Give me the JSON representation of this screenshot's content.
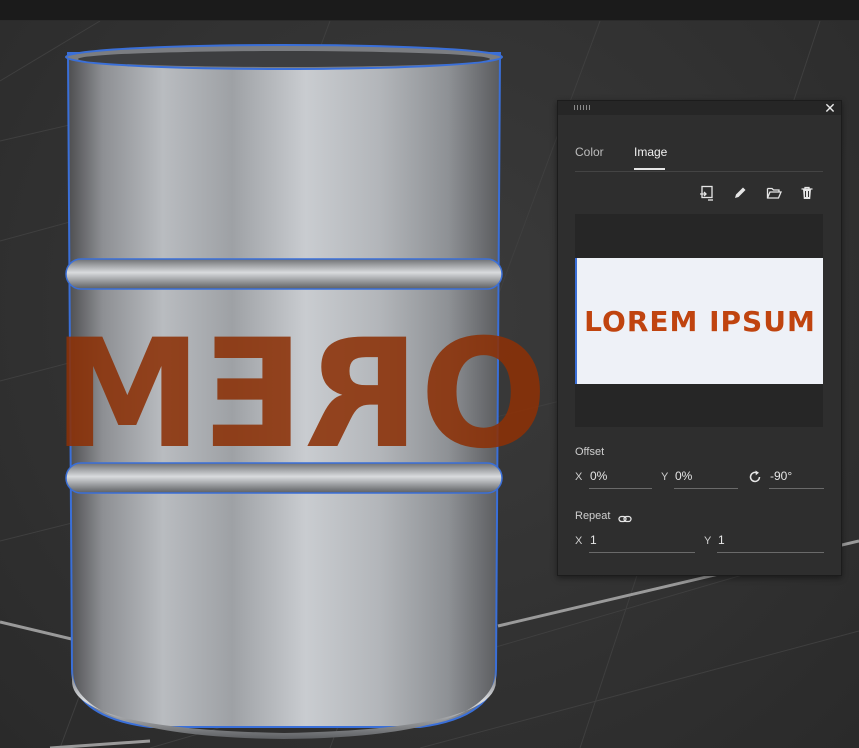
{
  "viewport": {
    "barrel_label_text": "OREM"
  },
  "panel": {
    "tabs": [
      {
        "label": "Color"
      },
      {
        "label": "Image"
      }
    ],
    "active_tab": "Image",
    "toolbar_icons": [
      "replace-image-icon",
      "edit-icon",
      "open-folder-icon",
      "delete-icon"
    ],
    "preview_text": "LOREM IPSUM",
    "offset": {
      "label": "Offset",
      "x_label": "X",
      "x_value": "0%",
      "y_label": "Y",
      "y_value": "0%",
      "rotation_value": "-90°"
    },
    "repeat": {
      "label": "Repeat",
      "x_label": "X",
      "x_value": "1",
      "y_label": "Y",
      "y_value": "1"
    }
  },
  "colors": {
    "accent_selection": "#3a6fd8",
    "label_orange": "#c0440f",
    "panel_bg": "#2e2e2e"
  }
}
